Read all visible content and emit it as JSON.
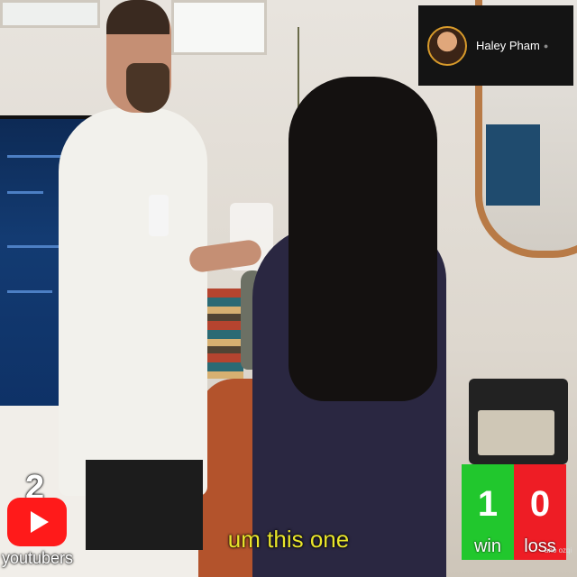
{
  "streamer": {
    "name": "Haley Pham",
    "status_dot": "●",
    "avatar_icon": "streamer-avatar-icon"
  },
  "youtubers_counter": {
    "count": "2",
    "label": "youtubers",
    "logo_icon": "youtube-play-icon",
    "logo_color": "#ff1a1a"
  },
  "scoreboard": {
    "win": {
      "value": "1",
      "label": "win",
      "color": "#21c72d"
    },
    "loss": {
      "value": "0",
      "label": "loss",
      "color": "#ee1d25"
    }
  },
  "caption": {
    "text": "um this one",
    "color": "#e9e52b"
  },
  "corner_mark": "ano ozqi"
}
